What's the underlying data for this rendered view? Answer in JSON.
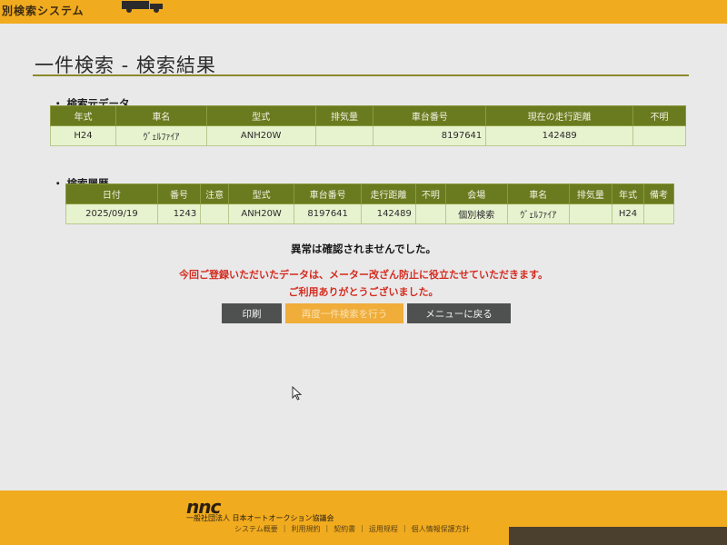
{
  "header": {
    "brand": "別検索システム"
  },
  "page": {
    "title": "一件検索 - 検索結果"
  },
  "source_section": {
    "label": "検索元データ",
    "columns": [
      "年式",
      "車名",
      "型式",
      "排気量",
      "車台番号",
      "現在の走行距離",
      "不明"
    ],
    "row": [
      "H24",
      "ｳﾞｪﾙﾌｧｲｱ",
      "ANH20W",
      "",
      "8197641",
      "142489",
      ""
    ]
  },
  "history_section": {
    "label": "検索履歴",
    "columns": [
      "日付",
      "番号",
      "注意",
      "型式",
      "車台番号",
      "走行距離",
      "不明",
      "会場",
      "車名",
      "排気量",
      "年式",
      "備考"
    ],
    "row": [
      "2025/09/19",
      "1243",
      "",
      "ANH20W",
      "8197641",
      "142489",
      "",
      "個別検索",
      "ｳﾞｪﾙﾌｧｲｱ",
      "",
      "H24",
      ""
    ]
  },
  "messages": {
    "result": "異常は確認されませんでした。",
    "notice_line1": "今回ご登録いただいたデータは、メーター改ざん防止に役立たせていただきます。",
    "notice_line2": "ご利用ありがとうございました。"
  },
  "buttons": {
    "print": "印刷",
    "research": "再度一件検索を行う",
    "menu": "メニューに戻る"
  },
  "footer": {
    "logo": "nnc",
    "org": "一般社団法人 日本オートオークション協議会",
    "links": [
      "システム概要",
      "利用規約",
      "契約書",
      "运用规程",
      "個人情報保護方針"
    ]
  },
  "colors": {
    "accent": "#f1ab1f",
    "table_header": "#6a7a1f",
    "table_cell": "#e7f2cf",
    "alert_red": "#d42b1e"
  }
}
